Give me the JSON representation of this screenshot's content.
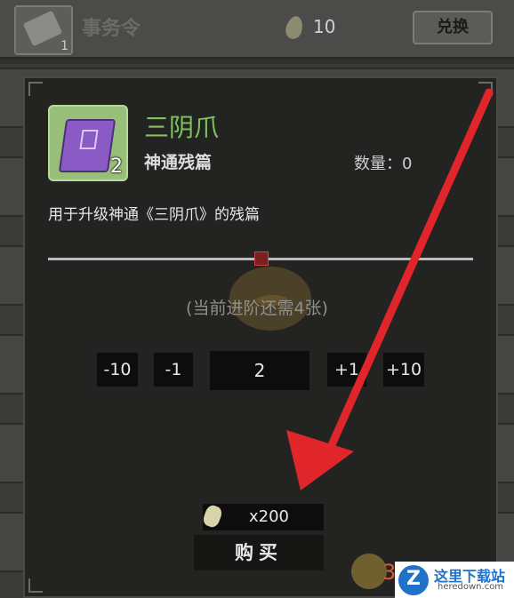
{
  "topbar": {
    "title": "事务令",
    "item_count": "1",
    "currency_count": "10",
    "exchange_label": "兑换"
  },
  "dialog": {
    "item_name": "三阴爪",
    "item_type": "神通残篇",
    "item_badge_count": "2",
    "quantity_label": "数量：0",
    "description": "用于升级神通《三阴爪》的残篇",
    "hint": "(当前进阶还需4张)",
    "steppers": {
      "minus10": "-10",
      "minus1": "-1",
      "value": "2",
      "plus1": "+1",
      "plus10": "+10"
    },
    "price": "x200",
    "buy_label": "购买"
  },
  "watermark": {
    "number": "3",
    "logo_letter": "Z",
    "site_name": "这里下载站",
    "site_url": "heredown.com"
  },
  "colors": {
    "item_name": "#7fc35e",
    "arrow": "#e1262b",
    "watermark_blue": "#1f72c8"
  }
}
